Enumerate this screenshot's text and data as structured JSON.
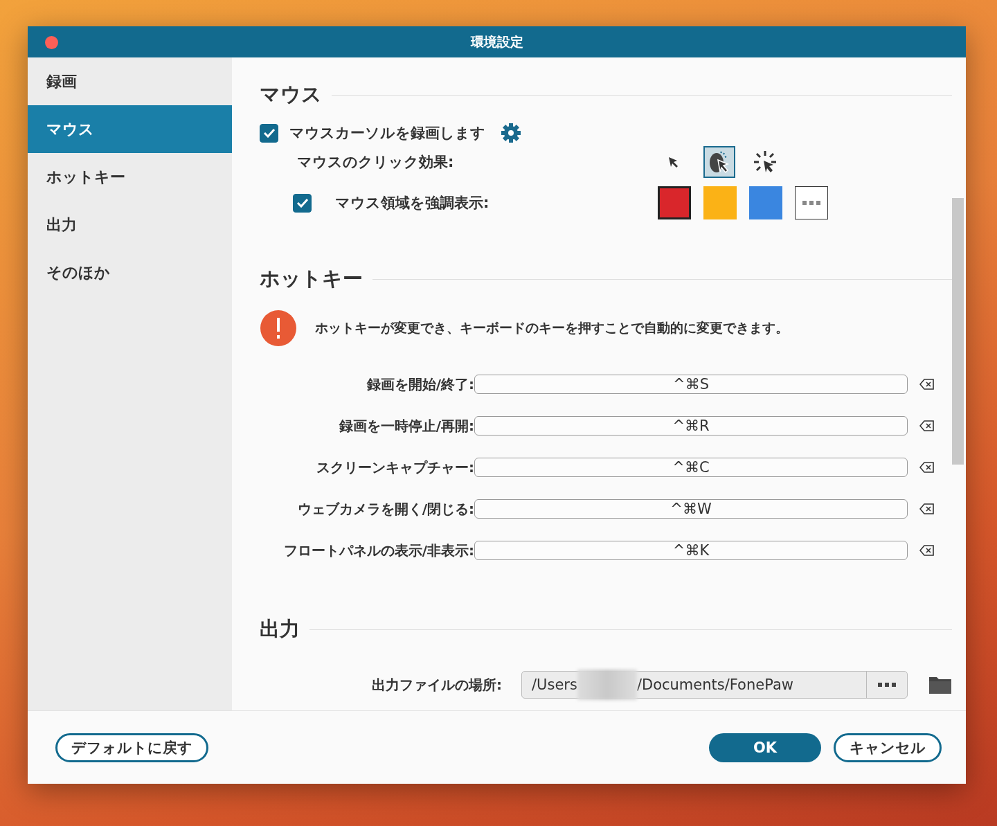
{
  "window": {
    "title": "環境設定"
  },
  "sidebar": {
    "items": [
      {
        "label": "録画",
        "selected": false
      },
      {
        "label": "マウス",
        "selected": true
      },
      {
        "label": "ホットキー",
        "selected": false
      },
      {
        "label": "出力",
        "selected": false
      },
      {
        "label": "そのほか",
        "selected": false
      }
    ]
  },
  "mouse": {
    "title": "マウス",
    "record_cursor": {
      "label": "マウスカーソルを録画します",
      "checked": true
    },
    "click_effect": {
      "label": "マウスのクリック効果:",
      "options": [
        {
          "kind": "arrow",
          "selected": false
        },
        {
          "kind": "mouse",
          "selected": true
        },
        {
          "kind": "burst",
          "selected": false
        }
      ]
    },
    "highlight": {
      "label": "マウス領域を強調表示:",
      "checked": true,
      "colors": [
        {
          "kind": "swatch",
          "color": "#d9262b",
          "selected": true
        },
        {
          "kind": "swatch",
          "color": "#fbb216",
          "selected": false
        },
        {
          "kind": "swatch",
          "color": "#3a86e0",
          "selected": false
        },
        {
          "kind": "more",
          "selected": false
        }
      ]
    }
  },
  "hotkeys": {
    "title": "ホットキー",
    "notice": "ホットキーが変更でき、キーボードのキーを押すことで自動的に変更できます。",
    "rows": [
      {
        "label": "録画を開始/終了:",
        "value": "^⌘S"
      },
      {
        "label": "録画を一時停止/再開:",
        "value": "^⌘R"
      },
      {
        "label": "スクリーンキャプチャー:",
        "value": "^⌘C"
      },
      {
        "label": "ウェブカメラを開く/閉じる:",
        "value": "^⌘W"
      },
      {
        "label": "フロートパネルの表示/非表示:",
        "value": "^⌘K"
      }
    ]
  },
  "output": {
    "title": "出力",
    "location_label": "出力ファイルの場所:",
    "path_parts": [
      "/Users",
      "/Documents/FonePaw"
    ]
  },
  "footer": {
    "reset": "デフォルトに戻す",
    "ok": "OK",
    "cancel": "キャンセル"
  }
}
